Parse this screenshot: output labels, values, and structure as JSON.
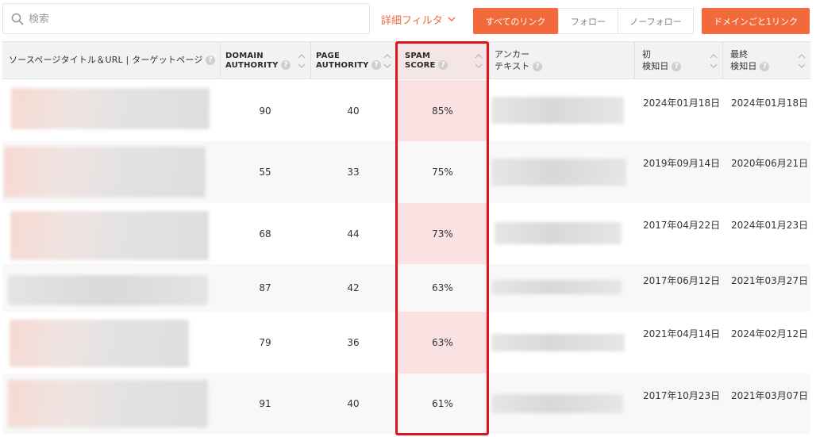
{
  "search": {
    "placeholder": "検索"
  },
  "toolbar": {
    "filter_label": "詳細フィルタ",
    "filter_chevron": "chevron-down-icon",
    "all_links": "すべてのリンク",
    "follow": "フォロー",
    "nofollow": "ノーフォロー",
    "per_domain": "ドメインごと1リンク"
  },
  "colors": {
    "accent": "#f26a3b",
    "highlight_border": "#e0141c",
    "highlight_fill": "#fbe2e2"
  },
  "columns": [
    {
      "key": "source",
      "label": "ソースページタイトル＆URL | ターゲットページ"
    },
    {
      "key": "da",
      "label_line1": "DOMAIN",
      "label_line2": "AUTHORITY"
    },
    {
      "key": "pa",
      "label_line1": "PAGE",
      "label_line2": "AUTHORITY"
    },
    {
      "key": "spam",
      "label_line1": "SPAM",
      "label_line2": "SCORE"
    },
    {
      "key": "anchor",
      "label_line1": "アンカー",
      "label_line2": "テキスト"
    },
    {
      "key": "first",
      "label_line1": "初",
      "label_line2": "検知日"
    },
    {
      "key": "last",
      "label_line1": "最終",
      "label_line2": "検知日"
    }
  ],
  "rows": [
    {
      "da": "90",
      "pa": "40",
      "spam": "85%",
      "first": "2024年01月18日",
      "last": "2024年01月18日"
    },
    {
      "da": "55",
      "pa": "33",
      "spam": "75%",
      "first": "2019年09月14日",
      "last": "2020年06月21日"
    },
    {
      "da": "68",
      "pa": "44",
      "spam": "73%",
      "first": "2017年04月22日",
      "last": "2024年01月23日"
    },
    {
      "da": "87",
      "pa": "42",
      "spam": "63%",
      "first": "2017年06月12日",
      "last": "2021年03月27日"
    },
    {
      "da": "79",
      "pa": "36",
      "spam": "63%",
      "first": "2021年04月14日",
      "last": "2024年02月12日"
    },
    {
      "da": "91",
      "pa": "40",
      "spam": "61%",
      "first": "2017年10月23日",
      "last": "2021年03月07日"
    }
  ]
}
